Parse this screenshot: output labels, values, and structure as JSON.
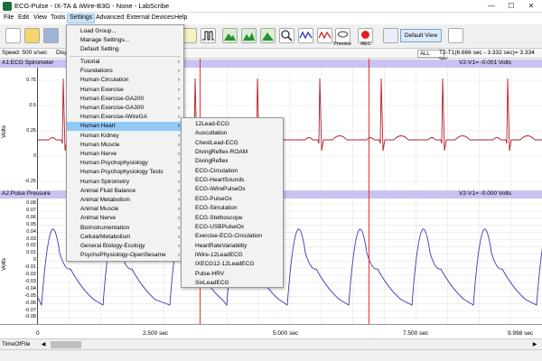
{
  "window": {
    "title": "ECG-Pulse - IX-TA & iWire-B3G  - None - LabScribe",
    "controls": [
      "—",
      "☐",
      "✕"
    ]
  },
  "menubar": {
    "items": [
      "File",
      "Edit",
      "View",
      "Tools",
      "Settings",
      "Advanced",
      "External Devices",
      "Help"
    ],
    "active": "Settings"
  },
  "toolbar": {
    "preview_label": "Preview",
    "rec_label": "REC",
    "default_view_label": "Default View"
  },
  "speedbar": {
    "speed": "Speed: 500 s/sec",
    "disp": "Disp",
    "all": "ALL",
    "marks": "T2-T1(6.666 sec - 3.332 sec)= 3.334 sec"
  },
  "channels": [
    {
      "header": "A1:ECG Spirometer",
      "readout": "V2-V1= -0.001 Volts",
      "ylabel": "Volts",
      "yticks": [
        "0.75",
        "0.5",
        "0.25",
        "0",
        "-0.25"
      ]
    },
    {
      "header": "A2:Pulse Pressure",
      "readout": "V2-V1= -0.000 Volts",
      "ylabel": "Volts",
      "yticks": [
        "0.08",
        "0.07",
        "0.06",
        "0.05",
        "0.04",
        "0.03",
        "0.02",
        "0.01",
        "0",
        "-0.01",
        "-0.02",
        "-0.03",
        "-0.04",
        "-0.05",
        "-0.06",
        "-0.07",
        "-0.08"
      ]
    }
  ],
  "xaxis": {
    "ticks": [
      "0",
      "2.500 sec",
      "5.000 sec",
      "7.500 sec",
      "9.998 sec"
    ],
    "time_label": "TimeOfFile"
  },
  "settings_menu": {
    "top_items": [
      "Load Group...",
      "Manage Settings...",
      "Default Setting"
    ],
    "sub_items": [
      "Tutorial",
      "Foundations",
      "Human Circulation",
      "Human Exercise",
      "Human Exercise-GA200",
      "Human Exercise-GA300",
      "Human Exercise-iWireGA",
      "Human Heart",
      "Human Kidney",
      "Human Muscle",
      "Human Nerve",
      "Human Psychophysiology",
      "Human Psychophysiology Tests",
      "Human Spirometry",
      "Animal Fluid Balance",
      "Animal Metabolism",
      "Animal Muscle",
      "Animal Nerve",
      "BioInstrumentation",
      "CellularMetabolism",
      "General Biology-Ecology",
      "PsychoPhysiology-OpenSesame"
    ],
    "highlighted": "Human Heart"
  },
  "heart_menu": {
    "items": [
      "12Lead-ECG",
      "Auscultation",
      "ChestLead-ECG",
      "DivingReflex-ROAM",
      "DivingReflex",
      "ECG-Circulation",
      "ECG-HeartSounds",
      "ECG-iWirePulseOx",
      "ECG-PulseOx",
      "ECG-Simulation",
      "ECG-Stethoscope",
      "ECG-USBPulseOx",
      "Exercise-ECG-Circulation",
      "HeartRateVariability",
      "iWire-12LeadECG",
      "IXECG12-12LeadECG",
      "Pulse-HRV",
      "SixLeadECG"
    ]
  },
  "colors": {
    "ecg_trace": "#b0202a",
    "pulse_trace": "#3a3ab0",
    "channel_header": "#c9c3f3",
    "cursor_line": "#e03030",
    "menu_highlight": "#91c9f7"
  }
}
